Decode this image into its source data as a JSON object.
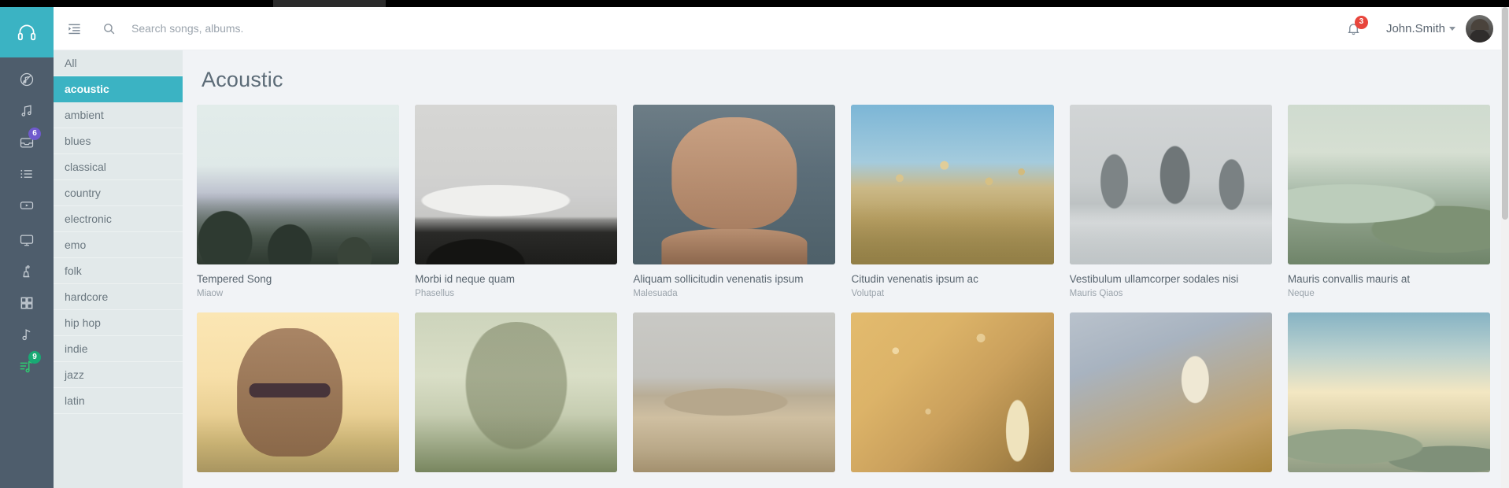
{
  "app": {
    "brand_icon": "headphones-icon",
    "accent_color": "#3bb3c3",
    "rail_color": "#4e5d6c"
  },
  "rail": {
    "items": [
      {
        "name": "no-music-icon",
        "badge": null
      },
      {
        "name": "music-note-double-icon",
        "badge": null
      },
      {
        "name": "inbox-icon",
        "badge": "6",
        "badge_color": "#6f5acd"
      },
      {
        "name": "list-icon",
        "badge": null
      },
      {
        "name": "video-play-icon",
        "badge": null
      },
      {
        "name": "monitor-icon",
        "badge": null
      },
      {
        "name": "microphone-icon",
        "badge": null
      },
      {
        "name": "grid-icon",
        "badge": null
      },
      {
        "name": "music-note-icon",
        "badge": null
      },
      {
        "name": "equalizer-note-icon",
        "badge": "9",
        "badge_color": "#19a974"
      }
    ]
  },
  "header": {
    "toggle_icon": "sidebar-toggle-icon",
    "search_icon": "search-icon",
    "search": {
      "value": "",
      "placeholder": "Search songs, albums."
    },
    "bell_icon": "bell-icon",
    "bell_badge": "3",
    "user_name": "John.Smith",
    "avatar_alt": "user-avatar"
  },
  "genres": {
    "items": [
      {
        "label": "All",
        "active": false
      },
      {
        "label": "acoustic",
        "active": true
      },
      {
        "label": "ambient",
        "active": false
      },
      {
        "label": "blues",
        "active": false
      },
      {
        "label": "classical",
        "active": false
      },
      {
        "label": "country",
        "active": false
      },
      {
        "label": "electronic",
        "active": false
      },
      {
        "label": "emo",
        "active": false
      },
      {
        "label": "folk",
        "active": false
      },
      {
        "label": "hardcore",
        "active": false
      },
      {
        "label": "hip hop",
        "active": false
      },
      {
        "label": "indie",
        "active": false
      },
      {
        "label": "jazz",
        "active": false
      },
      {
        "label": "latin",
        "active": false
      }
    ]
  },
  "main": {
    "title": "Acoustic",
    "cards": [
      {
        "title": "Tempered Song",
        "artist": "Miaow",
        "art": "a-forest"
      },
      {
        "title": "Morbi id neque quam",
        "artist": "Phasellus",
        "art": "a-mountain"
      },
      {
        "title": "Aliquam sollicitudin venenatis ipsum",
        "artist": "Malesuada",
        "art": "a-portrait"
      },
      {
        "title": "Citudin venenatis ipsum ac",
        "artist": "Volutpat",
        "art": "a-flower"
      },
      {
        "title": "Vestibulum ullamcorper sodales nisi",
        "artist": "Mauris Qiaos",
        "art": "a-trees-snow"
      },
      {
        "title": "Mauris convallis mauris at",
        "artist": "Neque",
        "art": "a-valley"
      },
      {
        "title": "",
        "artist": "",
        "art": "a-girl"
      },
      {
        "title": "",
        "artist": "",
        "art": "a-bigtree"
      },
      {
        "title": "",
        "artist": "",
        "art": "a-dune"
      },
      {
        "title": "",
        "artist": "",
        "art": "a-golden"
      },
      {
        "title": "",
        "artist": "",
        "art": "a-wheat"
      },
      {
        "title": "",
        "artist": "",
        "art": "a-hills"
      }
    ]
  }
}
